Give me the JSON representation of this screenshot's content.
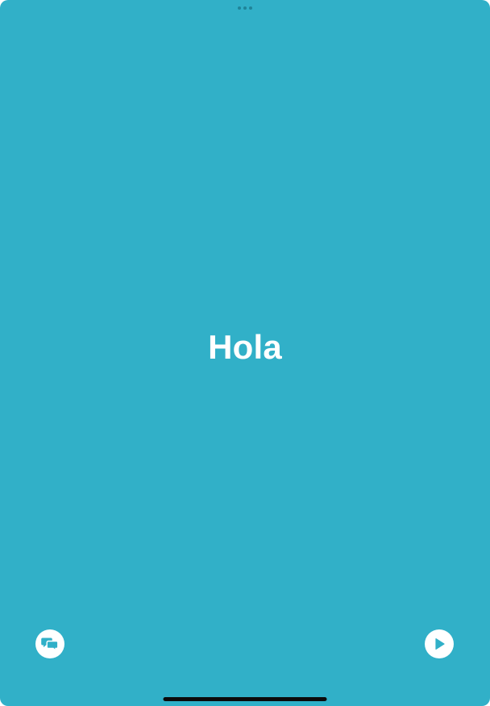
{
  "screen": {
    "background_color": "#31b0c8",
    "phrase": "Hola"
  },
  "controls": {
    "conversation_icon": "speech-bubbles-icon",
    "play_icon": "play-icon",
    "accent_color": "#31b0c8"
  },
  "system": {
    "multitask_icon": "ellipsis-icon",
    "home_indicator": "home-indicator"
  }
}
